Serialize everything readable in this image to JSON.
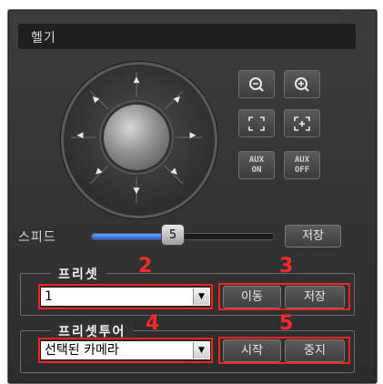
{
  "panel": {
    "title": "헬기"
  },
  "zoom_buttons": [
    {
      "name": "zoom-out-icon"
    },
    {
      "name": "zoom-in-icon"
    }
  ],
  "focus_buttons": [
    {
      "name": "focus-near-icon"
    },
    {
      "name": "focus-far-icon"
    }
  ],
  "aux": {
    "on": {
      "top": "AUX",
      "bottom": "ON"
    },
    "off": {
      "top": "AUX",
      "bottom": "OFF"
    }
  },
  "speed": {
    "label": "스피드",
    "value": "5",
    "level_fraction": 0.45,
    "save_label": "저장"
  },
  "preset": {
    "title": "프리셋",
    "selected": "1",
    "move_label": "이동",
    "save_label": "저장",
    "marker_select": "2",
    "marker_buttons": "3"
  },
  "preset_tour": {
    "title": "프리셋투어",
    "selected": "선택된 카메라",
    "start_label": "시작",
    "stop_label": "중지",
    "marker_select": "4",
    "marker_buttons": "5"
  },
  "colors": {
    "accent": "#3b7bff",
    "highlight": "#ff2020",
    "panel": "#333333"
  }
}
